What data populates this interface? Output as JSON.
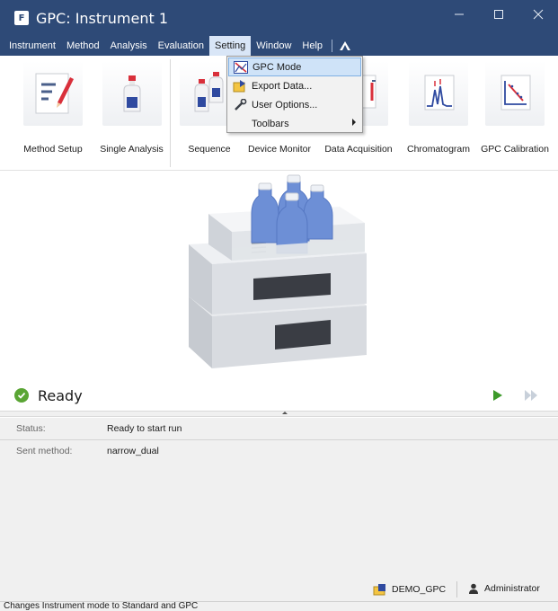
{
  "window": {
    "title": "GPC: Instrument 1",
    "logo_letter": "F"
  },
  "menu": {
    "items": [
      "Instrument",
      "Method",
      "Analysis",
      "Evaluation",
      "Setting",
      "Window",
      "Help"
    ],
    "active": "Setting"
  },
  "dropdown": {
    "items": [
      {
        "label": "GPC Mode",
        "icon": "gpc-mode-icon",
        "highlighted": true
      },
      {
        "label": "Export Data...",
        "icon": "export-data-icon"
      },
      {
        "label": "User Options...",
        "icon": "wrench-icon"
      },
      {
        "label": "Toolbars",
        "icon": "",
        "submenu": true
      }
    ]
  },
  "toolbar": {
    "items": [
      {
        "label": "Method Setup",
        "icon": "method-setup-icon"
      },
      {
        "label": "Single Analysis",
        "icon": "single-analysis-icon"
      },
      {
        "label": "Sequence",
        "icon": "sequence-icon"
      },
      {
        "label": "Device Monitor",
        "icon": "device-monitor-icon"
      },
      {
        "label": "Data Acquisition",
        "icon": "data-acquisition-icon"
      },
      {
        "label": "Chromatogram",
        "icon": "chromatogram-icon"
      },
      {
        "label": "GPC Calibration",
        "icon": "gpc-calibration-icon"
      }
    ]
  },
  "status": {
    "state": "Ready"
  },
  "info": {
    "status_key": "Status:",
    "status_value": "Ready to start run",
    "sent_key": "Sent method:",
    "sent_value": "narrow_dual"
  },
  "footer": {
    "project": "DEMO_GPC",
    "user": "Administrator"
  },
  "statusbar": {
    "text": "Changes Instrument mode to Standard and GPC"
  },
  "colors": {
    "title_bg": "#2e4a77",
    "ready_green": "#5aa534",
    "highlight": "#cfe3f8"
  }
}
